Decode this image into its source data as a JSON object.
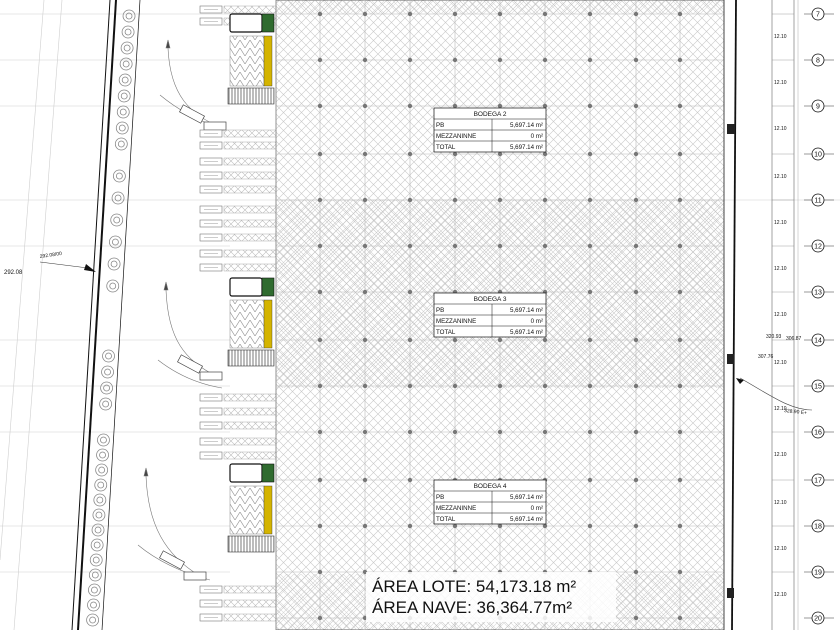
{
  "site_plan": {
    "left_dimension": "292.08",
    "left_leader_label": "292.08/00",
    "right_dims": [
      "320.93",
      "306.87",
      "307.76",
      "328.90 E+"
    ],
    "bay_dim": "12.10",
    "grid_numbers": [
      "7",
      "8",
      "9",
      "10",
      "11",
      "12",
      "13",
      "14",
      "15",
      "16",
      "17",
      "18",
      "19",
      "20"
    ],
    "warehouses": [
      {
        "name": "BODEGA 2",
        "rows": [
          {
            "label": "PB",
            "value": "5,697.14 m²"
          },
          {
            "label": "MEZZANINNE",
            "value": "0 m²"
          },
          {
            "label": "TOTAL",
            "value": "5,697.14 m²"
          }
        ]
      },
      {
        "name": "BODEGA 3",
        "rows": [
          {
            "label": "PB",
            "value": "5,697.14 m²"
          },
          {
            "label": "MEZZANINNE",
            "value": "0 m²"
          },
          {
            "label": "TOTAL",
            "value": "5,697.14 m²"
          }
        ]
      },
      {
        "name": "BODEGA 4",
        "rows": [
          {
            "label": "PB",
            "value": "5,697.14 m²"
          },
          {
            "label": "MEZZANINNE",
            "value": "0 m²"
          },
          {
            "label": "TOTAL",
            "value": "5,697.14 m²"
          }
        ]
      }
    ],
    "area_lote": "ÁREA LOTE: 54,173.18 m²",
    "area_nave": "ÁREA NAVE: 36,364.77m²"
  }
}
